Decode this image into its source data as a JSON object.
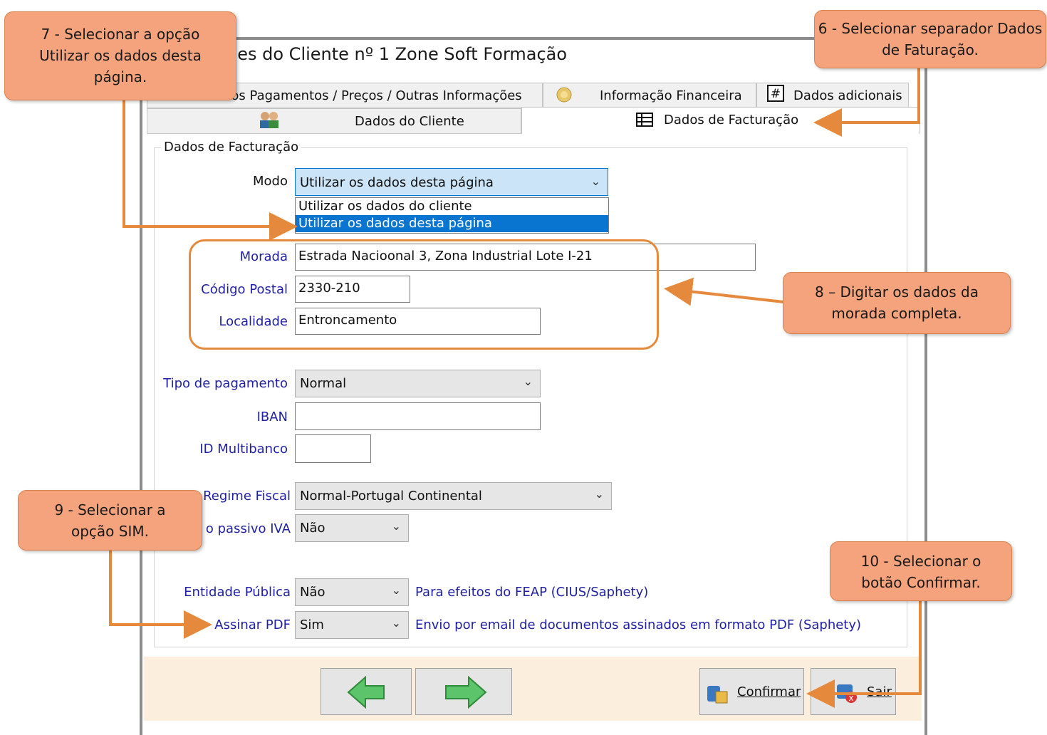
{
  "window": {
    "title": "des do Cliente nº 1 Zone Soft Formação"
  },
  "tabs_row1": [
    {
      "label": "Prazos Pagamentos / Preços / Outras Informações",
      "icon": "wrench-icon"
    },
    {
      "label": "Informação Financeira",
      "icon": "coins-icon"
    },
    {
      "label": "Dados adicionais",
      "icon": "hash-icon"
    }
  ],
  "tabs_row2": [
    {
      "label": "Dados do Cliente",
      "icon": "users-icon"
    },
    {
      "label": "Dados de Facturação",
      "icon": "table-icon"
    }
  ],
  "group_label": "Dados de Facturação",
  "form": {
    "modo_label": "Modo",
    "modo_value": "Utilizar os dados desta página",
    "modo_options": [
      "Utilizar os dados do cliente",
      "Utilizar os dados desta página"
    ],
    "morada_label": "Morada",
    "morada_value": "Estrada Nacioonal 3, Zona Industrial Lote I-21",
    "codigo_postal_label": "Código Postal",
    "codigo_postal_value": "2330-210",
    "localidade_label": "Localidade",
    "localidade_value": "Entroncamento",
    "tipo_pagamento_label": "Tipo de pagamento",
    "tipo_pagamento_value": "Normal",
    "iban_label": "IBAN",
    "iban_value": "",
    "id_multibanco_label": "ID Multibanco",
    "id_multibanco_value": "",
    "regime_fiscal_label": "Regime Fiscal",
    "regime_fiscal_value": "Normal-Portugal Continental",
    "sujeito_passivo_label": "o passivo IVA",
    "sujeito_passivo_value": "Não",
    "entidade_publica_label": "Entidade Pública",
    "entidade_publica_value": "Não",
    "entidade_publica_note": "Para efeitos do FEAP (CIUS/Saphety)",
    "assinar_pdf_label": "Assinar PDF",
    "assinar_pdf_value": "Sim",
    "assinar_pdf_note": "Envio por email de documentos assinados em formato PDF (Saphety)"
  },
  "buttons": {
    "confirmar": "Confirmar",
    "sair": "Sair"
  },
  "callouts": {
    "c6": "6 - Selecionar separador Dados de Faturação.",
    "c7": "7 - Selecionar a opção Utilizar os dados desta página.",
    "c8": "8 – Digitar os dados da morada completa.",
    "c9": "9 - Selecionar a opção SIM.",
    "c10": "10 - Selecionar o botão Confirmar."
  },
  "colors": {
    "callout_fill": "#f4a37c",
    "arrow": "#e58a3c",
    "selection": "#0a74d1",
    "label_blue": "#1f1fa3",
    "bottom_bar": "#fbeedd"
  }
}
